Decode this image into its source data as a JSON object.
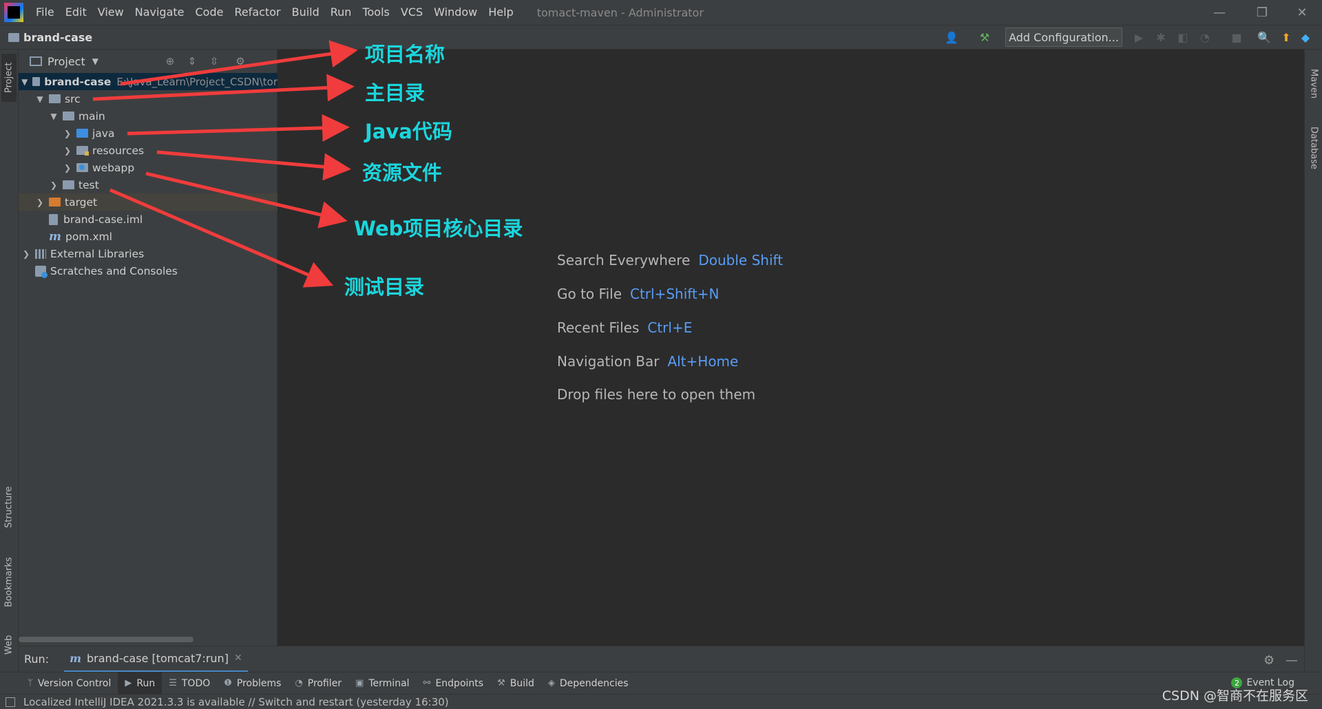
{
  "menubar": {
    "items": [
      "File",
      "Edit",
      "View",
      "Navigate",
      "Code",
      "Refactor",
      "Build",
      "Run",
      "Tools",
      "VCS",
      "Window",
      "Help"
    ],
    "window_title": "tomact-maven - Administrator",
    "minimize": "—",
    "restore": "❐",
    "close": "✕"
  },
  "navbar": {
    "breadcrumb": "brand-case",
    "add_configuration": "Add Configuration...",
    "icons": [
      "user-icon",
      "hammer-icon",
      "run-icon",
      "debug-icon",
      "coverage-icon",
      "profile-icon",
      "stop-icon",
      "search-icon",
      "update-icon",
      "toolbox-icon"
    ]
  },
  "left_stripe": {
    "tabs": [
      "Project",
      "Structure",
      "Bookmarks",
      "Web"
    ]
  },
  "right_stripe": {
    "tabs": [
      "Maven",
      "Database"
    ]
  },
  "project_panel": {
    "title": "Project",
    "tree": [
      {
        "label": "brand-case",
        "path": "E:\\Java_Learn\\Project_CSDN\\tor",
        "icon": "folder-icon"
      },
      {
        "label": "src",
        "icon": "folder-icon"
      },
      {
        "label": "main",
        "icon": "folder-icon"
      },
      {
        "label": "java",
        "icon": "source-folder-icon"
      },
      {
        "label": "resources",
        "icon": "resources-folder-icon"
      },
      {
        "label": "webapp",
        "icon": "web-folder-icon"
      },
      {
        "label": "test",
        "icon": "folder-icon"
      },
      {
        "label": "target",
        "icon": "excluded-folder-icon"
      },
      {
        "label": "brand-case.iml",
        "icon": "iml-file-icon"
      },
      {
        "label": "pom.xml",
        "icon": "maven-file-icon"
      },
      {
        "label": "External Libraries",
        "icon": "libraries-icon"
      },
      {
        "label": "Scratches and Consoles",
        "icon": "scratches-icon"
      }
    ]
  },
  "editor": {
    "hints": [
      {
        "action": "Search Everywhere",
        "shortcut": "Double Shift"
      },
      {
        "action": "Go to File",
        "shortcut": "Ctrl+Shift+N"
      },
      {
        "action": "Recent Files",
        "shortcut": "Ctrl+E"
      },
      {
        "action": "Navigation Bar",
        "shortcut": "Alt+Home"
      },
      {
        "action": "Drop files here to open them",
        "shortcut": ""
      }
    ]
  },
  "annotations": {
    "project_name": "项目名称",
    "main_dir": "主目录",
    "java_code": "Java代码",
    "resources": "资源文件",
    "web_core": "Web项目核心目录",
    "test_dir": "测试目录",
    "arrow_color": "#f03c3c",
    "text_color": "#1bd6dd"
  },
  "run_bar": {
    "label": "Run:",
    "tab_icon": "m",
    "tab_label": "brand-case [tomcat7:run]",
    "tab_close": "✕"
  },
  "tool_windows": [
    {
      "label": "Version Control",
      "icon": "vcs-icon"
    },
    {
      "label": "Run",
      "icon": "run-icon"
    },
    {
      "label": "TODO",
      "icon": "todo-icon"
    },
    {
      "label": "Problems",
      "icon": "problems-icon"
    },
    {
      "label": "Profiler",
      "icon": "profiler-icon"
    },
    {
      "label": "Terminal",
      "icon": "terminal-icon"
    },
    {
      "label": "Endpoints",
      "icon": "endpoints-icon"
    },
    {
      "label": "Build",
      "icon": "build-icon"
    },
    {
      "label": "Dependencies",
      "icon": "dependencies-icon"
    }
  ],
  "event_log": {
    "count": "2",
    "label": "Event Log"
  },
  "status_bar": {
    "text": "Localized IntelliJ IDEA 2021.3.3 is available // Switch and restart (yesterday 16:30)"
  },
  "watermark": "CSDN @智商不在服务区"
}
